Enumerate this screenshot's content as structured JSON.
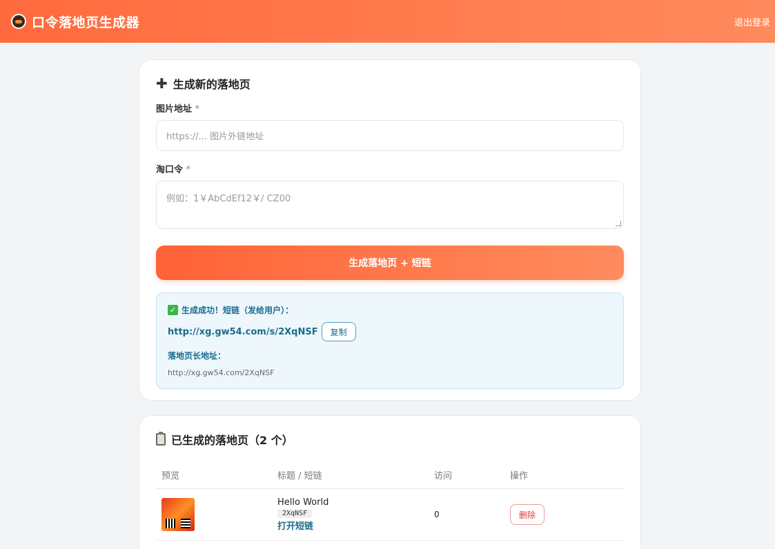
{
  "header": {
    "title": "口令落地页生成器",
    "logout": "退出登录"
  },
  "form": {
    "section_title": "生成新的落地页",
    "image_label": "图片地址",
    "image_required": "*",
    "image_placeholder": "https://... 图片外链地址",
    "code_label": "淘口令",
    "code_required": "*",
    "code_placeholder": "例如：1￥AbCdEf12￥/ CZ00",
    "submit_label": "生成落地页 + 短链"
  },
  "result": {
    "success_text": "生成成功！短链（发给用户）：",
    "short_url": "http://xg.gw54.com/s/2XqNSF",
    "copy_label": "复制",
    "long_label": "落地页长地址：",
    "long_url": "http://xg.gw54.com/2XqNSF"
  },
  "list": {
    "section_title": "已生成的落地页（2 个）",
    "columns": [
      "预览",
      "标题 / 短链",
      "访问",
      "操作"
    ],
    "rows": [
      {
        "title": "Hello World",
        "code": "2XqNSF",
        "open_label": "打开短链",
        "visits": "0",
        "delete_label": "删除"
      }
    ]
  }
}
